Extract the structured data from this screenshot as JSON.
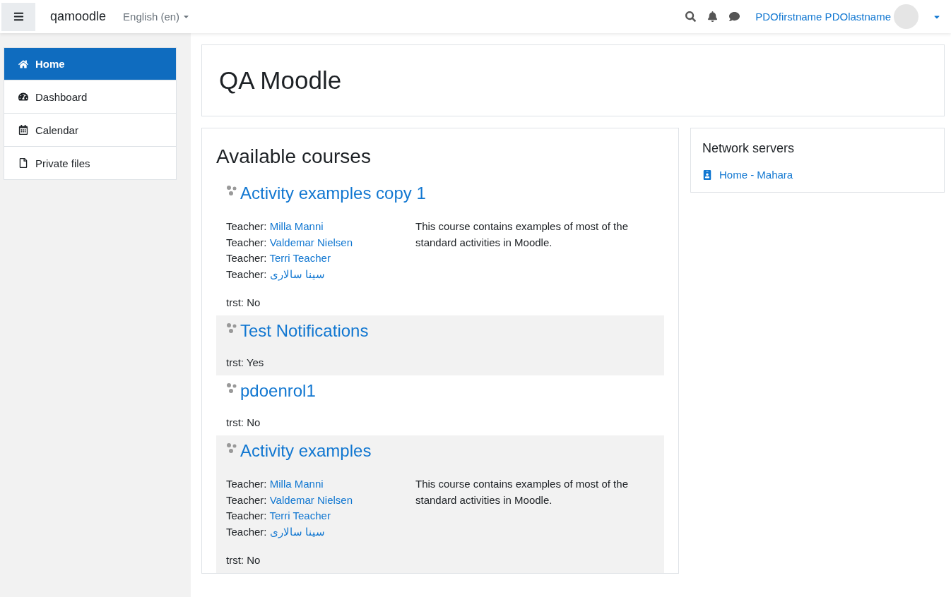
{
  "navbar": {
    "brand": "qamoodle",
    "language": "English (en)",
    "user_name": "PDOfirstname PDOlastname"
  },
  "nav_drawer": {
    "items": [
      {
        "label": "Home",
        "kind": "home",
        "selected": true
      },
      {
        "label": "Dashboard",
        "kind": "dashboard",
        "selected": false
      },
      {
        "label": "Calendar",
        "kind": "calendar",
        "selected": false
      },
      {
        "label": "Private files",
        "kind": "file",
        "selected": false
      }
    ]
  },
  "page_header": {
    "title": "QA Moodle"
  },
  "available_courses": {
    "title": "Available courses",
    "courses": [
      {
        "name": "Activity examples copy 1",
        "teachers": [
          {
            "label": "Teacher:",
            "name": "Milla Manni"
          },
          {
            "label": "Teacher:",
            "name": "Valdemar Nielsen"
          },
          {
            "label": "Teacher:",
            "name": "Terri Teacher"
          },
          {
            "label": "Teacher:",
            "name": "سینا سالاری"
          }
        ],
        "summary": "This course contains examples of most of the standard activities in Moodle.",
        "field": "trst: No"
      },
      {
        "name": "Test Notifications",
        "field": "trst: Yes"
      },
      {
        "name": "pdoenrol1",
        "field": "trst: No"
      },
      {
        "name": "Activity examples",
        "teachers": [
          {
            "label": "Teacher:",
            "name": "Milla Manni"
          },
          {
            "label": "Teacher:",
            "name": "Valdemar Nielsen"
          },
          {
            "label": "Teacher:",
            "name": "Terri Teacher"
          },
          {
            "label": "Teacher:",
            "name": "سینا سالاری"
          }
        ],
        "summary": "This course contains examples of most of the standard activities in Moodle.",
        "field": "trst: No"
      }
    ]
  },
  "network_servers": {
    "title": "Network servers",
    "links": [
      {
        "label": "Home - Mahara"
      }
    ]
  }
}
